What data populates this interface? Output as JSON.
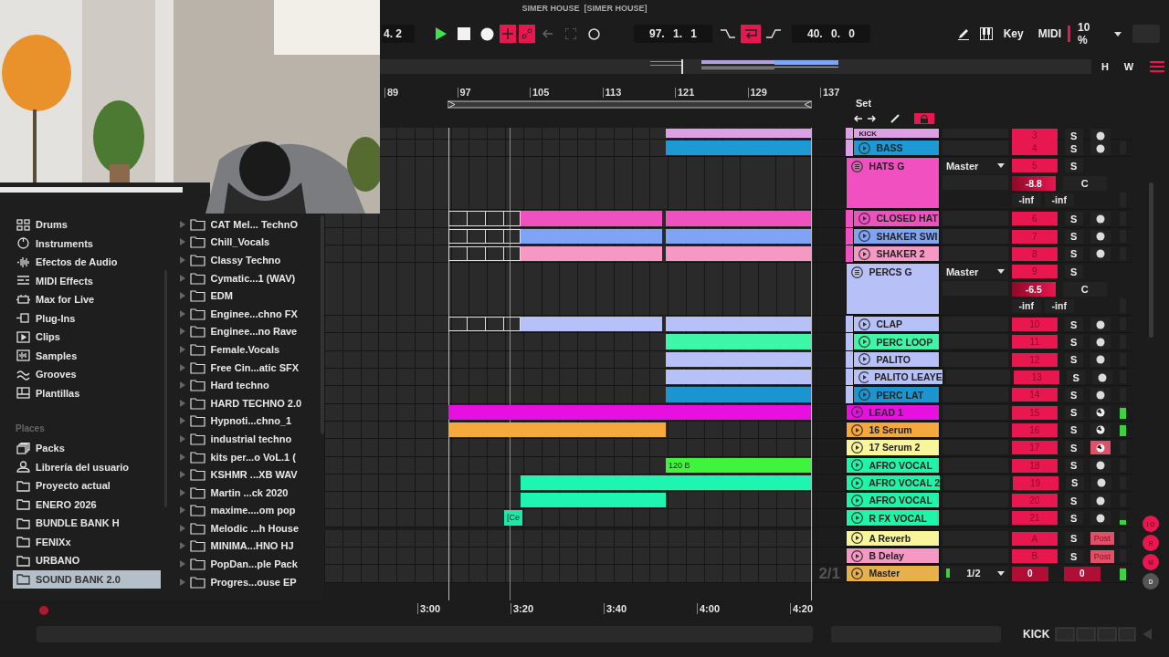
{
  "window": {
    "title": "SIMER HOUSE  [SIMER HOUSE]"
  },
  "transport": {
    "signature": "4. 2",
    "overdub_on": true,
    "automation_on": true,
    "position": "97. 1. 1",
    "loop_on": true,
    "loop_length": "40. 0. 0",
    "key_label": "Key",
    "midi_label": "MIDI",
    "zoom": "10 %"
  },
  "overview": {
    "buttons": [
      "H",
      "W"
    ]
  },
  "ruler": {
    "bars": [
      "89",
      "97",
      "105",
      "113",
      "121",
      "129",
      "137"
    ]
  },
  "set_panel": {
    "title": "Set",
    "lock_on": true
  },
  "browser": {
    "categories": [
      "Drums",
      "Instruments",
      "Efectos de Audio",
      "MIDI Effects",
      "Max for Live",
      "Plug-Ins",
      "Clips",
      "Samples",
      "Grooves",
      "Plantillas"
    ],
    "places_title": "Places",
    "places": [
      {
        "label": "Packs",
        "selected": false
      },
      {
        "label": "Librería del usuario",
        "selected": false
      },
      {
        "label": "Proyecto actual",
        "selected": false
      },
      {
        "label": "ENERO 2026",
        "selected": false
      },
      {
        "label": "BUNDLE BANK H",
        "selected": false
      },
      {
        "label": "FENIXx",
        "selected": false
      },
      {
        "label": "URBANO",
        "selected": false
      },
      {
        "label": "SOUND BANK 2.0",
        "selected": true
      }
    ],
    "folders": [
      "CAT  Mel... TechnO",
      "Chill_Vocals",
      "Classy Techno",
      "Cymatic...1 (WAV)",
      "EDM",
      "Enginee...chno FX",
      "Enginee...no Rave",
      "Female.Vocals",
      "Free Cin...atic SFX",
      "Hard techno",
      "HARD TECHNO 2.0",
      "Hypnoti...chno_1",
      "industrial techno",
      "kits per...o VoL.1 (",
      "KSHMR ...XB WAV",
      "Martin ...ck 2020",
      "maxime....om pop",
      "Melodic ...h House",
      "MINIMA...HNO HJ",
      "PopDan...ple Pack",
      "Progres...ouse EP"
    ]
  },
  "tracks": [
    {
      "kind": "group-continued",
      "color": "#dca0e4",
      "children": [
        {
          "kind": "track",
          "name": "KICK",
          "color": "#dca0e4",
          "number": "3",
          "solo": "S",
          "monitoring": false,
          "armed": false,
          "clips": [
            {
              "kind": "audio",
              "color": "#dca0e4"
            }
          ]
        },
        {
          "kind": "track",
          "name": "BASS",
          "color": "#1b9ad6",
          "number": "4",
          "solo": "S",
          "monitoring": false,
          "armed": false,
          "clips": [
            {
              "kind": "audio",
              "color": "#1b9ad6"
            }
          ]
        }
      ]
    },
    {
      "kind": "group",
      "name": "HATS G",
      "color": "#f050c0",
      "number": "5",
      "solo": "S",
      "output": "Master",
      "volume": "-8.8",
      "pan": "C",
      "peaks": [
        "-inf",
        "-inf"
      ],
      "children": [
        {
          "kind": "track",
          "name": "CLOSED HAT",
          "color": "#f050c0",
          "number": "6",
          "solo": "S",
          "monitoring": false,
          "armed": false,
          "clips": [
            {
              "kind": "outline"
            },
            {
              "kind": "audio",
              "color": "#f050c0"
            },
            {
              "kind": "audio",
              "color": "#f050c0"
            }
          ]
        },
        {
          "kind": "track",
          "name": "SHAKER SWI",
          "color": "#7fa3f5",
          "number": "7",
          "solo": "S",
          "monitoring": false,
          "armed": false,
          "clips": [
            {
              "kind": "outline"
            },
            {
              "kind": "audio",
              "color": "#7fa3f5"
            },
            {
              "kind": "audio",
              "color": "#7fa3f5"
            }
          ]
        },
        {
          "kind": "track",
          "name": "SHAKER 2",
          "color": "#f598c4",
          "number": "8",
          "solo": "S",
          "monitoring": false,
          "armed": false,
          "clips": [
            {
              "kind": "outline"
            },
            {
              "kind": "audio",
              "color": "#f598c4"
            },
            {
              "kind": "audio",
              "color": "#f598c4"
            }
          ]
        }
      ]
    },
    {
      "kind": "group",
      "name": "PERCS G",
      "color": "#b8c0f8",
      "number": "9",
      "solo": "S",
      "output": "Master",
      "volume": "-6.5",
      "pan": "C",
      "peaks": [
        "-inf",
        "-inf"
      ],
      "children": [
        {
          "kind": "track",
          "name": "CLAP",
          "color": "#b8c0f8",
          "number": "10",
          "solo": "S",
          "monitoring": false,
          "armed": false,
          "clips": [
            {
              "kind": "outline"
            },
            {
              "kind": "audio",
              "color": "#b8c0f8"
            },
            {
              "kind": "audio",
              "color": "#b8c0f8"
            }
          ]
        },
        {
          "kind": "track",
          "name": "PERC LOOP",
          "color": "#3ff5a8",
          "number": "11",
          "solo": "S",
          "monitoring": false,
          "armed": false,
          "clips": [
            {
              "kind": "audio",
              "color": "#3ff5a8"
            }
          ]
        },
        {
          "kind": "track",
          "name": "PALITO",
          "color": "#b8c0f8",
          "number": "12",
          "solo": "S",
          "monitoring": false,
          "armed": false,
          "clips": [
            {
              "kind": "audio",
              "color": "#b8c0f8"
            }
          ]
        },
        {
          "kind": "track",
          "name": "PALITO LEAYE",
          "color": "#b8c0f8",
          "number": "13",
          "solo": "S",
          "monitoring": false,
          "armed": false,
          "clips": [
            {
              "kind": "audio",
              "color": "#b8c0f8"
            }
          ]
        },
        {
          "kind": "track",
          "name": "PERC LAT",
          "color": "#1b95d0",
          "number": "14",
          "solo": "S",
          "monitoring": false,
          "armed": false,
          "clips": [
            {
              "kind": "audio",
              "color": "#1b95d0"
            }
          ]
        }
      ]
    },
    {
      "kind": "track",
      "name": "LEAD 1",
      "color": "#e810e0",
      "number": "15",
      "solo": "S",
      "monitoring": true,
      "armed": false,
      "level": 0.85,
      "clips": [
        {
          "kind": "audio",
          "color": "#e810e0"
        }
      ]
    },
    {
      "kind": "track",
      "name": "16 Serum",
      "color": "#f5a83c",
      "number": "16",
      "solo": "S",
      "monitoring": true,
      "armed": false,
      "level": 0.85,
      "clips": [
        {
          "kind": "audio",
          "color": "#f5a83c"
        }
      ]
    },
    {
      "kind": "track",
      "name": "17 Serum 2",
      "color": "#f8f59a",
      "number": "17",
      "solo": "S",
      "monitoring": true,
      "armed": true
    },
    {
      "kind": "track",
      "name": "AFRO VOCAL",
      "color": "#1ef5a8",
      "number": "18",
      "solo": "S",
      "monitoring": false,
      "armed": false,
      "clips": [
        {
          "kind": "audio",
          "color": "#3ef53c",
          "text": "120 B"
        }
      ]
    },
    {
      "kind": "track",
      "name": "AFRO VOCAL 2",
      "color": "#1ef5a8",
      "number": "19",
      "solo": "S",
      "monitoring": false,
      "armed": false,
      "clips": [
        {
          "kind": "audio",
          "color": "#1ef5b0"
        }
      ]
    },
    {
      "kind": "track",
      "name": "AFRO VOCAL",
      "color": "#1ef5a8",
      "number": "20",
      "solo": "S",
      "monitoring": false,
      "armed": false,
      "clips": [
        {
          "kind": "audio",
          "color": "#1ef5b0"
        }
      ]
    },
    {
      "kind": "track",
      "name": "R FX VOCAL",
      "color": "#1ef5a8",
      "number": "21",
      "solo": "S",
      "monitoring": false,
      "armed": false,
      "level": 0.3,
      "clips": [
        {
          "kind": "audio",
          "color": "#1ee8a8",
          "text": "[Ce"
        }
      ]
    },
    {
      "kind": "return",
      "name": "A Reverb",
      "color": "#f8f59a",
      "number": "A",
      "solo": "S",
      "send": "Post"
    },
    {
      "kind": "return",
      "name": "B Delay",
      "color": "#f598c4",
      "number": "B",
      "solo": "S",
      "send": "Post"
    },
    {
      "kind": "master",
      "name": "Master",
      "color": "#e8b04a",
      "output": "1/2",
      "volumes": [
        "0",
        "0"
      ],
      "level": 0.9
    }
  ],
  "time_ruler": {
    "times": [
      "3:00",
      "3:20",
      "3:40",
      "4:00",
      "4:20"
    ],
    "zoom_ratio": "2/1"
  },
  "side_buttons": [
    {
      "label": "I O",
      "on": true
    },
    {
      "label": "R",
      "on": true
    },
    {
      "label": "M",
      "on": true
    },
    {
      "label": "D",
      "on": false
    }
  ],
  "status_bar": {
    "track": "KICK"
  }
}
